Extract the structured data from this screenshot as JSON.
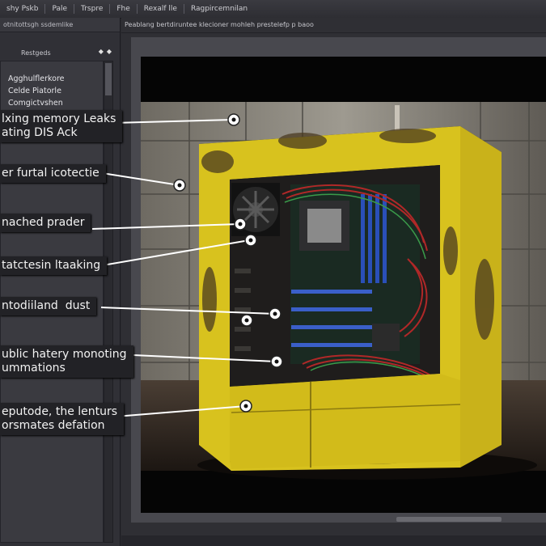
{
  "menu": [
    "shy Pskb",
    "Pale",
    "Trspre",
    "Fhe",
    "Rexalf lle",
    "Ragpircemnilan"
  ],
  "left_panel": {
    "header": "otnitottsgh ssdemlike",
    "section_title": "Restgeds",
    "items": [
      "Agghulflerkore",
      "Celde Piatorle",
      "Comgictvshen"
    ]
  },
  "main": {
    "header": "Peablang bertdiruntee klecioner mohleh prestelefp p baoo"
  },
  "callouts": [
    "lxing memory Leaks\nating DIS Ack",
    "er furtal icotectie",
    "nached prader",
    "tatctesin ltaaking",
    "ntodiiland  dust",
    "ublic hatery monoting\nummations",
    "eputode, the lenturs\norsmates defation"
  ],
  "colors": {
    "case_yellow": "#d8c21e",
    "rust": "#4a3a20",
    "cable_red": "#b02828",
    "ram_blue": "#2a4fb8"
  }
}
